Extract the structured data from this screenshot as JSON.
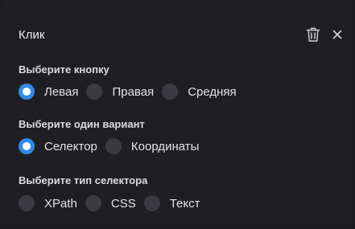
{
  "dialog": {
    "title": "Клик",
    "icons": {
      "delete": "trash-icon",
      "close": "close-icon"
    }
  },
  "sections": [
    {
      "label": "Выберите кнопку",
      "options": [
        {
          "label": "Левая",
          "checked": true
        },
        {
          "label": "Правая",
          "checked": false
        },
        {
          "label": "Средняя",
          "checked": false
        }
      ]
    },
    {
      "label": "Выберите один вариант",
      "options": [
        {
          "label": "Селектор",
          "checked": true
        },
        {
          "label": "Координаты",
          "checked": false
        }
      ]
    },
    {
      "label": "Выберите тип селектора",
      "options": [
        {
          "label": "XPath",
          "checked": false
        },
        {
          "label": "CSS",
          "checked": false
        },
        {
          "label": "Текст",
          "checked": false
        }
      ]
    }
  ],
  "colors": {
    "background": "#1f1f23",
    "accent": "#2f8ae8",
    "radio_unchecked": "#3a3a41",
    "text": "#e4e4e6"
  }
}
